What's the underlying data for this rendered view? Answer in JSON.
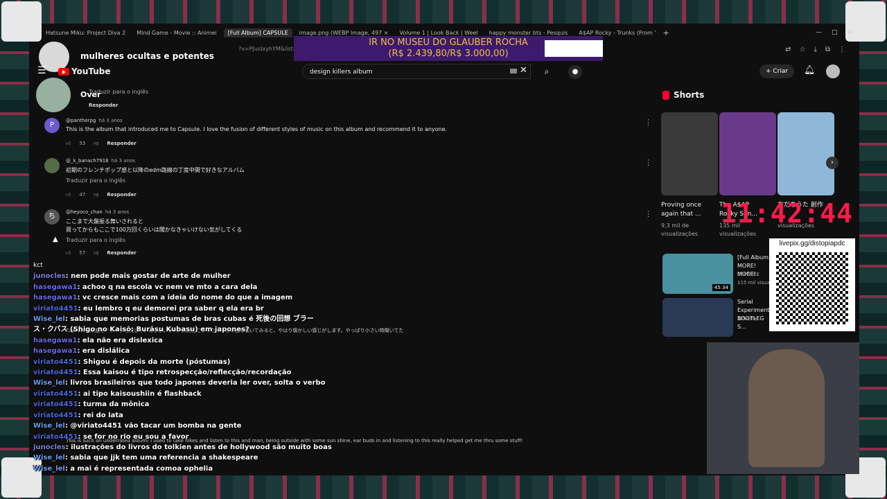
{
  "browser": {
    "tabs": [
      {
        "label": "Hatsune Miku: Project Diva 2"
      },
      {
        "label": "Mind Game - Movie :: Animei"
      },
      {
        "label": "[Full Album] CAPSULE"
      },
      {
        "label": "image.png (WEBP Image, 497 ×"
      },
      {
        "label": "Volume 1 | Look Back | Weel"
      },
      {
        "label": "happy monster bts - Pesquis"
      },
      {
        "label": "A$AP Rocky - Trunks (From '"
      }
    ],
    "new_tab": "+",
    "url": "?v=PJusIxyhYM&list=RDpPJusIxyhYM"
  },
  "overlay": {
    "title": "mulheres ocultas e potentes",
    "over_label": "Over",
    "banner_line1": "IR NO MUSEU DO GLAUBER ROCHA",
    "banner_line2": "(R$ 2.439,80/R$ 3.000,00)",
    "clock": "11:42:44",
    "qr_label": "livepix.gg/distopiapdc",
    "kct": "kct"
  },
  "youtube": {
    "logo_text": "YouTube",
    "search_value": "design killers album",
    "create_label": "Criar"
  },
  "comments": [
    {
      "avatar": "P",
      "author": "@pantherpg",
      "time": "há 3 anos",
      "text": "This is the album that introduced me to Capsule. I love the fusion of different styles of music on this album and recommend it to anyone.",
      "likes": "53",
      "reply": "Responder"
    },
    {
      "avatar": "",
      "author": "@_k_banach7918",
      "time": "há 3 anos",
      "text": "初期のフレンチポップ感と以降のedm路線の丁度中間で好きなアルバム",
      "translate": "Traduzir para o inglês",
      "likes": "47",
      "reply": "Responder"
    },
    {
      "avatar": "ち",
      "author": "@heyoco_chan",
      "time": "há 3 anos",
      "text": "ここまで大盤振る舞いされると",
      "text2": "買ってからもここで100万回くらいは聞かなきゃいけない気がしてくる",
      "translate": "Traduzir para o inglês",
      "likes": "57",
      "reply": "Responder"
    }
  ],
  "top_reply": "Responder",
  "top_translate": "Traduzir para o inglês",
  "comment_under": "Capsuleの楽曲をドライブに流していたらしいです。高校生になった今、この曲を聴いてみると、やはり懐かしい感じがします。やっぱり小さい時聞いてた",
  "comment_under2": "This is such an underrated album! I used to take hikes and listen to this and man, being outside with some sun shine, ear buds in and listening to this really helped get me thru some stuff!",
  "chat": [
    {
      "user": "junocles",
      "cls": "",
      "msg": ": nem pode mais gostar de arte de mulher"
    },
    {
      "user": "hasegawa1",
      "cls": "hase",
      "msg": ": achoo q na escola vc nem ve mto a cara dela"
    },
    {
      "user": "hasegawa1",
      "cls": "hase",
      "msg": ": vc cresce mais com a ideia do nome do que a imagem"
    },
    {
      "user": "viriato4451",
      "cls": "viriato",
      "msg": ": eu lembro q eu demorei pra saber q ela era br"
    },
    {
      "user": "Wise_lel",
      "cls": "wise",
      "msg": ": sabia que memorias postumas de bras cubas é 死後の回想 ブラー"
    },
    {
      "user": "",
      "cls": "",
      "msg": "ス・クバス (Shigo no Kaisō: Burāsu Kubasu) em japones?"
    },
    {
      "user": "hasegawa1",
      "cls": "hase",
      "msg": ": ela não era dislexica"
    },
    {
      "user": "hasegawa1",
      "cls": "hase",
      "msg": ": era dislálica"
    },
    {
      "user": "viriato4451",
      "cls": "viriato",
      "msg": ": Shigou é depois da morte (póstumas)"
    },
    {
      "user": "viriato4451",
      "cls": "viriato",
      "msg": ": Essa kaisou é tipo retrospecção/reflecção/recordação"
    },
    {
      "user": "Wise_lel",
      "cls": "wise",
      "msg": ": livros brasileiros que todo japones deveria ler over, solta o verbo"
    },
    {
      "user": "viriato4451",
      "cls": "viriato",
      "msg": ": ai tipo kaisoushiin é flashback"
    },
    {
      "user": "viriato4451",
      "cls": "viriato",
      "msg": ": turma da mônica"
    },
    {
      "user": "viriato4451",
      "cls": "viriato",
      "msg": ": rei do lata"
    },
    {
      "user": "Wise_lel",
      "cls": "wise",
      "msg": ": @viriato4451 vão tacar um bomba na gente"
    },
    {
      "user": "viriato4451",
      "cls": "viriato",
      "msg": ": se for no rio eu sou a favor"
    },
    {
      "user": "junocles",
      "cls": "",
      "msg": ": ilustrações do livros do tolkien antes de hollywood são muito boas"
    },
    {
      "user": "Wise_lel",
      "cls": "wise",
      "msg": ": sabia que jjk tem uma referencia a shakespeare"
    },
    {
      "user": "Wise_lel",
      "cls": "wise",
      "msg": ": a mai é representada comoa ophelia"
    }
  ],
  "shorts": {
    "heading": "Shorts",
    "items": [
      {
        "title": "Proving once again that ...",
        "views": "9,3 mil de visualizações",
        "color": "#3a3a3a"
      },
      {
        "title": "The A$AP Rocky Son...",
        "views": "135 mil visualizações",
        "color": "#6a3a8a"
      },
      {
        "title": "友だちうた 創作",
        "views": "visualizações",
        "color": "#8fb8d8"
      }
    ]
  },
  "recommended": [
    {
      "title": "[Full Album] MORE! MORE!",
      "channel": "CAPSULE",
      "views": "115 mil visualizações",
      "duration": "45:34"
    },
    {
      "title": "Serial Experiments BOOTLEG S...",
      "channel": "AtTuUhH",
      "views": "311 mil visualizações"
    }
  ]
}
